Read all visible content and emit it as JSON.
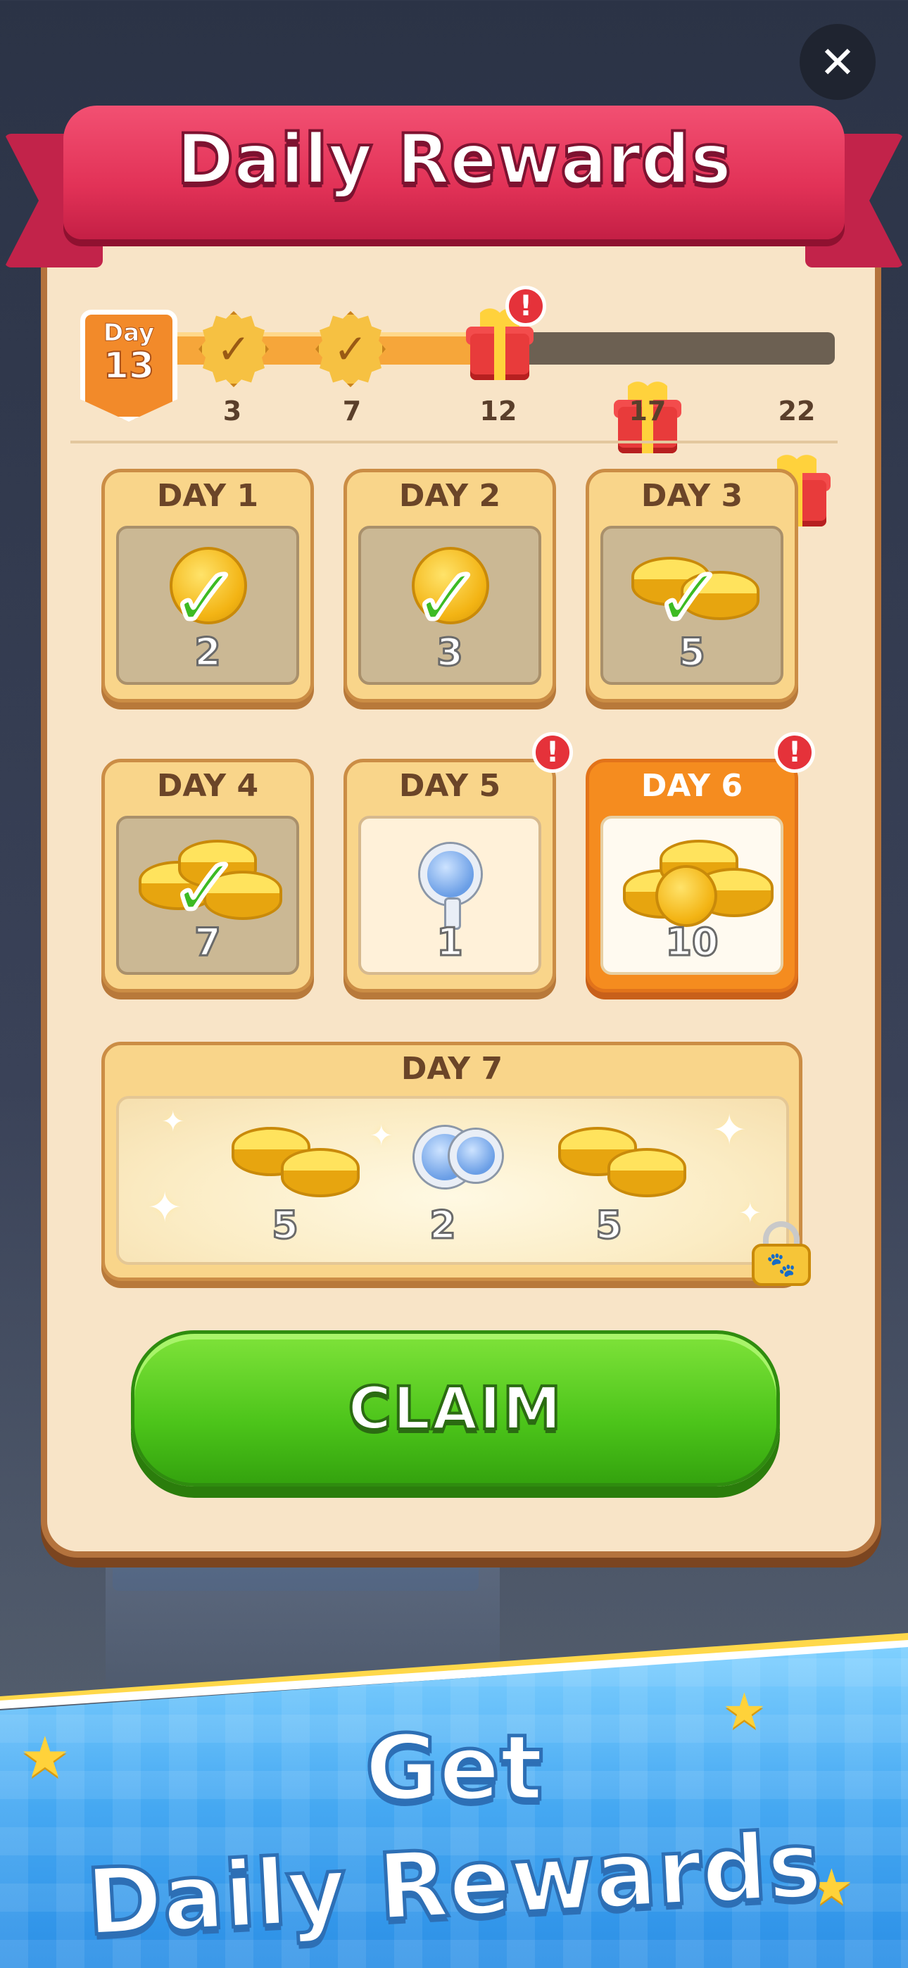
{
  "close": {
    "label": "✕"
  },
  "title": "Daily Rewards",
  "progress": {
    "day_label": "Day",
    "current_day": "13",
    "milestones": [
      "3",
      "7",
      "12",
      "17",
      "22"
    ],
    "alert": "!"
  },
  "days": [
    {
      "label": "DAY 1",
      "qty": "2"
    },
    {
      "label": "DAY 2",
      "qty": "3"
    },
    {
      "label": "DAY 3",
      "qty": "5"
    },
    {
      "label": "DAY 4",
      "qty": "7"
    },
    {
      "label": "DAY 5",
      "qty": "1"
    },
    {
      "label": "DAY 6",
      "qty": "10"
    }
  ],
  "day7": {
    "label": "DAY 7",
    "qtys": [
      "5",
      "2",
      "5"
    ]
  },
  "claim_label": "CLAIM",
  "promo": {
    "line1": "Get",
    "line2": "Daily Rewards"
  },
  "colors": {
    "claim_green": "#4cc41a",
    "banner_red": "#e23257",
    "active_orange": "#f58c1f",
    "panel_bg": "#f8e4c7"
  }
}
